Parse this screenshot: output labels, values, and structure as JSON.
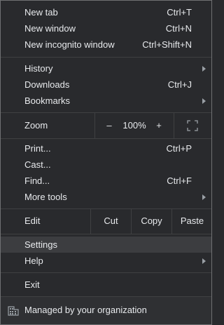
{
  "menu": {
    "new_tab": {
      "label": "New tab",
      "accel": "Ctrl+T"
    },
    "new_window": {
      "label": "New window",
      "accel": "Ctrl+N"
    },
    "new_incognito": {
      "label": "New incognito window",
      "accel": "Ctrl+Shift+N"
    },
    "history": {
      "label": "History"
    },
    "downloads": {
      "label": "Downloads",
      "accel": "Ctrl+J"
    },
    "bookmarks": {
      "label": "Bookmarks"
    },
    "zoom": {
      "label": "Zoom",
      "minus": "–",
      "level": "100%",
      "plus": "+"
    },
    "print": {
      "label": "Print...",
      "accel": "Ctrl+P"
    },
    "cast": {
      "label": "Cast..."
    },
    "find": {
      "label": "Find...",
      "accel": "Ctrl+F"
    },
    "more_tools": {
      "label": "More tools"
    },
    "edit": {
      "label": "Edit",
      "cut": "Cut",
      "copy": "Copy",
      "paste": "Paste"
    },
    "settings": {
      "label": "Settings"
    },
    "help": {
      "label": "Help"
    },
    "exit": {
      "label": "Exit"
    },
    "managed": {
      "label": "Managed by your organization"
    }
  },
  "icons": {
    "fullscreen": "fullscreen-icon",
    "building": "building-icon",
    "submenu": "chevron-right-icon"
  },
  "colors": {
    "background": "#292a2d",
    "text": "#e8eaed",
    "highlight": "#3c3d40",
    "separator": "#3f4042"
  }
}
